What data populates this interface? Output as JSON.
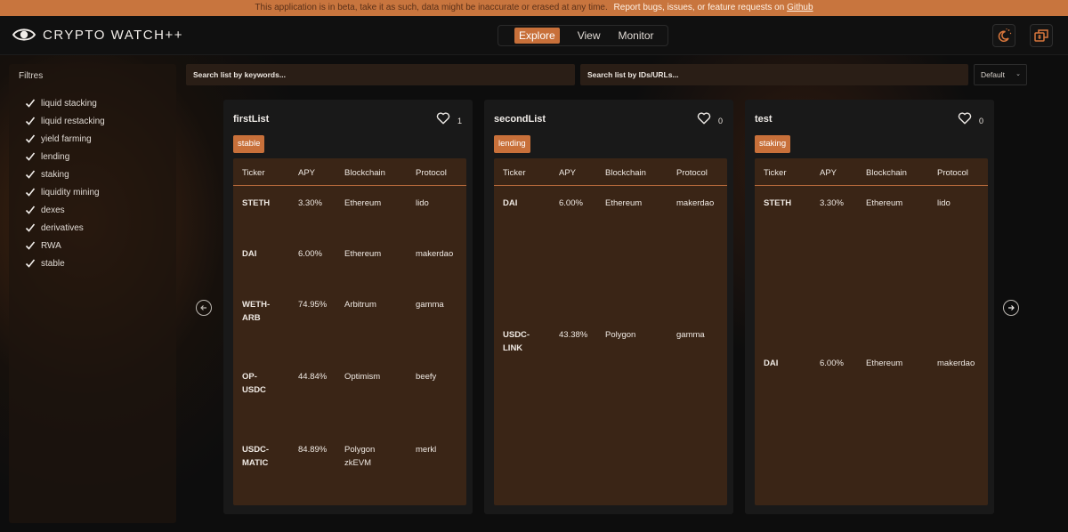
{
  "banner": {
    "message": "This application is in beta, take it as such, data might be inaccurate or erased at any time.",
    "report": "Report bugs, issues, or feature requests on",
    "link": "Github"
  },
  "header": {
    "logo_text": "CRYPTO WATCH++",
    "nav": [
      "Explore",
      "View",
      "Monitor"
    ],
    "active_nav": "Explore",
    "icons": [
      "theme-toggle-icon",
      "wallet-icon"
    ],
    "accent": "#c8703a"
  },
  "sidebar": {
    "title": "Filtres",
    "filters": [
      "liquid stacking",
      "liquid restacking",
      "yield farming",
      "lending",
      "staking",
      "liquidity mining",
      "dexes",
      "derivatives",
      "RWA",
      "stable"
    ]
  },
  "search": {
    "keywords_placeholder": "Search list by keywords...",
    "ids_placeholder": "Search list by IDs/URLs..."
  },
  "sort": {
    "value": "Default"
  },
  "columns": [
    "Ticker",
    "APY",
    "Blockchain",
    "Protocol"
  ],
  "lists": [
    {
      "title": "firstList",
      "likes": "1",
      "tag": "stable",
      "rows": [
        {
          "ticker": "STETH",
          "apy": "3.30%",
          "chain": "Ethereum",
          "protocol": "lido"
        },
        {
          "ticker": "DAI",
          "apy": "6.00%",
          "chain": "Ethereum",
          "protocol": "makerdao"
        },
        {
          "ticker": "WETH-\nARB",
          "apy": "74.95%",
          "chain": "Arbitrum",
          "protocol": "gamma"
        },
        {
          "ticker": "OP-\nUSDC",
          "apy": "44.84%",
          "chain": "Optimism",
          "protocol": "beefy"
        },
        {
          "ticker": "USDC-\nMATIC",
          "apy": "84.89%",
          "chain": "Polygon\nzkEVM",
          "protocol": "merkl"
        }
      ]
    },
    {
      "title": "secondList",
      "likes": "0",
      "tag": "lending",
      "rows": [
        {
          "ticker": "DAI",
          "apy": "6.00%",
          "chain": "Ethereum",
          "protocol": "makerdao"
        },
        {
          "ticker": "USDC-\nLINK",
          "apy": "43.38%",
          "chain": "Polygon",
          "protocol": "gamma"
        }
      ]
    },
    {
      "title": "test",
      "likes": "0",
      "tag": "staking",
      "rows": [
        {
          "ticker": "STETH",
          "apy": "3.30%",
          "chain": "Ethereum",
          "protocol": "lido"
        },
        {
          "ticker": "DAI",
          "apy": "6.00%",
          "chain": "Ethereum",
          "protocol": "makerdao"
        }
      ]
    }
  ]
}
